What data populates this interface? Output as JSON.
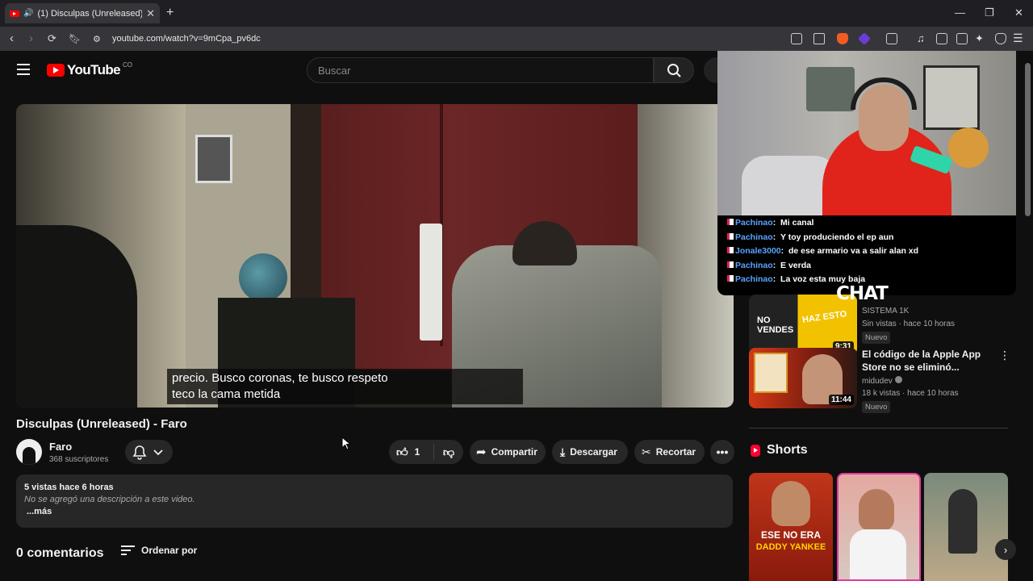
{
  "browser": {
    "tab_title": "(1) Disculpas (Unreleased) - F",
    "url": "youtube.com/watch?v=9mCpa_pv6dc",
    "notif_badge": "2"
  },
  "header": {
    "logo": "YouTube",
    "logo_suffix": "CO",
    "search_placeholder": "Buscar"
  },
  "video": {
    "caption_line1": "precio. Busco coronas, te busco respeto",
    "caption_line2": "teco la cama metida",
    "title": "Disculpas (Unreleased) - Faro",
    "channel": "Faro",
    "subscribers": "368 suscriptores",
    "likes": "1",
    "share_label": "Compartir",
    "download_label": "Descargar",
    "clip_label": "Recortar",
    "views_meta": "5 vistas  hace 6 horas",
    "no_description": "No se agregó una descripción a este video.",
    "more_label": "...más",
    "comments_count": "0 comentarios",
    "sort_label": "Ordenar por"
  },
  "overlay": {
    "chat": [
      {
        "user": "Pachinao",
        "message": "Mi canal"
      },
      {
        "user": "Pachinao",
        "message": "Y toy produciendo el ep aun"
      },
      {
        "user": "Jonale3000",
        "message": "de ese armario va a salir alan xd"
      },
      {
        "user": "Pachinao",
        "message": "E verda"
      },
      {
        "user": "Pachinao",
        "message": "La voz esta muy baja"
      }
    ],
    "chat_label": "CHAT"
  },
  "recommended": [
    {
      "thumb_text": "NO VENDES",
      "thumb_text2": "HAZ ESTO",
      "duration": "9:31",
      "channel": "SISTEMA 1K",
      "meta": "Sin vistas · hace 10 horas",
      "badge": "Nuevo"
    },
    {
      "title": "El código de la Apple App Store no se eliminó...",
      "duration": "11:44",
      "channel": "midudev",
      "meta": "18 k vistas · hace 10 horas",
      "badge": "Nuevo"
    }
  ],
  "shorts": {
    "title": "Shorts",
    "items": [
      {
        "text": "ESE NO ERA",
        "text2": "DADDY YANKEE"
      },
      {
        "text": ""
      },
      {
        "text": ""
      }
    ]
  },
  "colors": {
    "yt_red": "#ff0000",
    "background": "#0f0f0f",
    "chat_user": "#5aa3ff",
    "hoodie": "#e0241b"
  }
}
